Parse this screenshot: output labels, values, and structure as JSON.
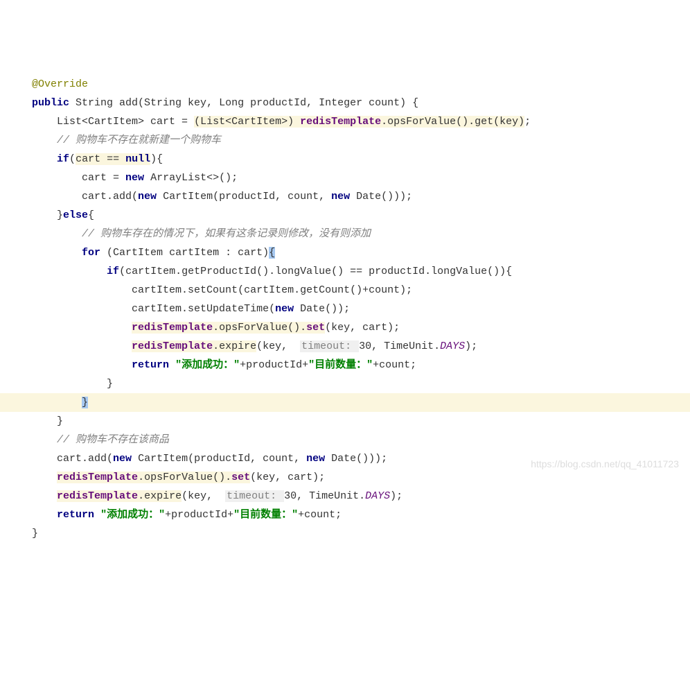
{
  "code": {
    "l1": "@Override",
    "l2_public": "public",
    "l2_rest": " String add(String key, Long productId, Integer count) {",
    "l3_a": "    List<CartItem> cart = ",
    "l3_b": "(List<CartItem>) ",
    "l3_c": "redisTemplate",
    "l3_d": ".opsForValue().get(key)",
    "l3_e": ";",
    "l4_comment": "    // 购物车不存在就新建一个购物车",
    "l5_a": "    ",
    "l5_if": "if",
    "l5_b": "(",
    "l5_c": "cart == ",
    "l5_null": "null",
    "l5_d": "){",
    "l6_a": "        cart = ",
    "l6_new": "new",
    "l6_b": " ArrayList<>();",
    "l7_a": "        cart.add(",
    "l7_new": "new",
    "l7_b": " CartItem(productId, count, ",
    "l7_new2": "new",
    "l7_c": " Date()));",
    "l8_a": "    }",
    "l8_else": "else",
    "l8_b": "{",
    "l9_comment": "        // 购物车存在的情况下，如果有这条记录则修改，没有则添加",
    "l10_a": "        ",
    "l10_for": "for",
    "l10_b": " (CartItem cartItem : cart)",
    "l10_c": "{",
    "l11_a": "            ",
    "l11_if": "if",
    "l11_b": "(cartItem.getProductId().longValue() == productId.longValue()){",
    "l12_a": "                cartItem.setCount(cartItem.getCount()+count);",
    "l13_a": "                cartItem.setUpdateTime(",
    "l13_new": "new",
    "l13_b": " Date());",
    "l14_a": "                ",
    "l14_b": "redisTemplate",
    "l14_c": ".opsForValue().",
    "l14_set": "set",
    "l14_d": "(key, cart);",
    "l15_a": "                ",
    "l15_b": "redisTemplate",
    "l15_c": ".expire",
    "l15_d": "(key,  ",
    "l15_hint": "timeout: ",
    "l15_e": "30, TimeUnit.",
    "l15_days": "DAYS",
    "l15_f": ");",
    "l16_a": "                ",
    "l16_return": "return",
    "l16_b": " ",
    "l16_s1": "\"添加成功：\"",
    "l16_c": "+productId+",
    "l16_s2": "\"目前数量：\"",
    "l16_d": "+count;",
    "l17_a": "            }",
    "l18_a": "        ",
    "l18_b": "}",
    "l19_a": "    }",
    "l20_comment": "    // 购物车不存在该商品",
    "l21_a": "    cart.add(",
    "l21_new": "new",
    "l21_b": " CartItem(productId, count, ",
    "l21_new2": "new",
    "l21_c": " Date()));",
    "l22_a": "    ",
    "l22_b": "redisTemplate",
    "l22_c": ".opsForValue().",
    "l22_set": "set",
    "l22_d": "(key, cart);",
    "l23_a": "    ",
    "l23_b": "redisTemplate",
    "l23_c": ".expire",
    "l23_d": "(key,  ",
    "l23_hint": "timeout: ",
    "l23_e": "30, TimeUnit.",
    "l23_days": "DAYS",
    "l23_f": ");",
    "l24_a": "    ",
    "l24_return": "return",
    "l24_b": " ",
    "l24_s1": "\"添加成功：\"",
    "l24_c": "+productId+",
    "l24_s2": "\"目前数量：\"",
    "l24_d": "+count;",
    "l25_a": "}"
  },
  "watermark": "https://blog.csdn.net/qq_41011723"
}
